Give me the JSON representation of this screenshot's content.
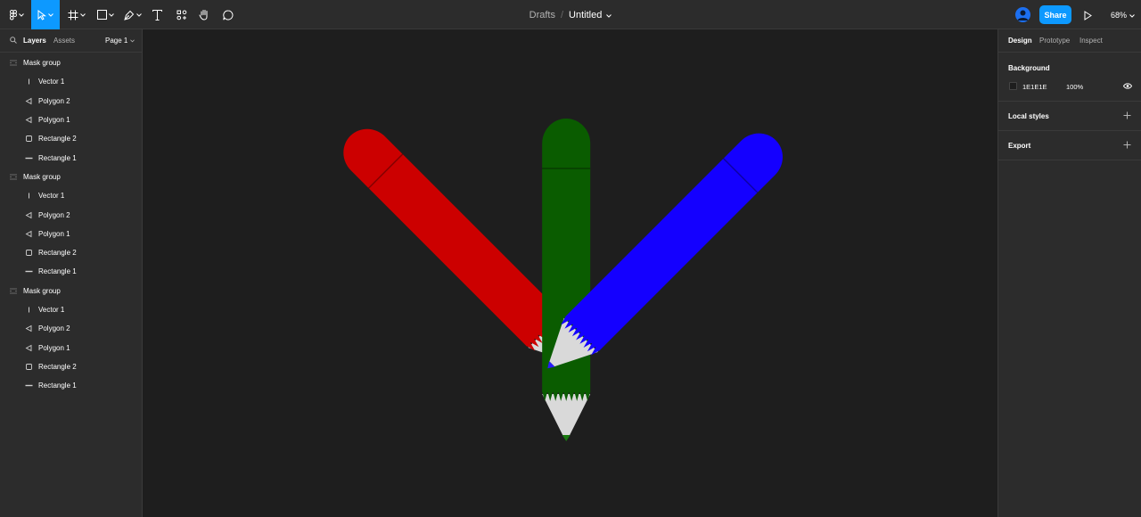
{
  "toolbar": {
    "breadcrumb": "Drafts",
    "separator": "/",
    "file_name": "Untitled",
    "share_label": "Share",
    "zoom": "68%",
    "active_color": "#0d99ff",
    "tools": [
      "figma-menu-icon",
      "move-tool-icon",
      "frame-tool-icon",
      "shape-tool-icon",
      "pen-tool-icon",
      "text-tool-icon",
      "resources-icon",
      "hand-tool-icon",
      "comment-tool-icon"
    ]
  },
  "left_panel": {
    "tab_layers": "Layers",
    "tab_assets": "Assets",
    "page_label": "Page 1",
    "layers": [
      {
        "label": "Mask group",
        "type": "group",
        "icon": "mask-group-icon"
      },
      {
        "label": "Vector 1",
        "type": "child",
        "icon": "vector-icon"
      },
      {
        "label": "Polygon 2",
        "type": "child",
        "icon": "polygon-icon"
      },
      {
        "label": "Polygon 1",
        "type": "child",
        "icon": "polygon-icon"
      },
      {
        "label": "Rectangle 2",
        "type": "child",
        "icon": "rectangle-icon"
      },
      {
        "label": "Rectangle 1",
        "type": "child",
        "icon": "line-rectangle-icon"
      },
      {
        "label": "Mask group",
        "type": "group",
        "icon": "mask-group-icon"
      },
      {
        "label": "Vector 1",
        "type": "child",
        "icon": "vector-icon"
      },
      {
        "label": "Polygon 2",
        "type": "child",
        "icon": "polygon-icon"
      },
      {
        "label": "Polygon 1",
        "type": "child",
        "icon": "polygon-icon"
      },
      {
        "label": "Rectangle 2",
        "type": "child",
        "icon": "rectangle-icon"
      },
      {
        "label": "Rectangle 1",
        "type": "child",
        "icon": "line-rectangle-icon"
      },
      {
        "label": "Mask group",
        "type": "group",
        "icon": "mask-group-icon"
      },
      {
        "label": "Vector 1",
        "type": "child",
        "icon": "vector-icon"
      },
      {
        "label": "Polygon 2",
        "type": "child",
        "icon": "polygon-icon"
      },
      {
        "label": "Polygon 1",
        "type": "child",
        "icon": "polygon-icon"
      },
      {
        "label": "Rectangle 2",
        "type": "child",
        "icon": "rectangle-icon"
      },
      {
        "label": "Rectangle 1",
        "type": "child",
        "icon": "line-rectangle-icon"
      }
    ]
  },
  "canvas": {
    "background": "#1e1e1e",
    "pencils": [
      {
        "name": "red-pencil",
        "color": "#cc0000",
        "cap_color": "#c20000",
        "tip_color": "#e11717"
      },
      {
        "name": "green-pencil",
        "color": "#0a5c00",
        "cap_color": "#0a5500",
        "tip_color": "#1a7a10"
      },
      {
        "name": "blue-pencil",
        "color": "#1400ff",
        "cap_color": "#1200ee",
        "tip_color": "#2a1aff"
      }
    ],
    "wood_color": "#d9d9d9"
  },
  "right_panel": {
    "tab_design": "Design",
    "tab_prototype": "Prototype",
    "tab_inspect": "Inspect",
    "background_title": "Background",
    "background_hex": "1E1E1E",
    "background_opacity": "100%",
    "local_styles_title": "Local styles",
    "export_title": "Export"
  }
}
